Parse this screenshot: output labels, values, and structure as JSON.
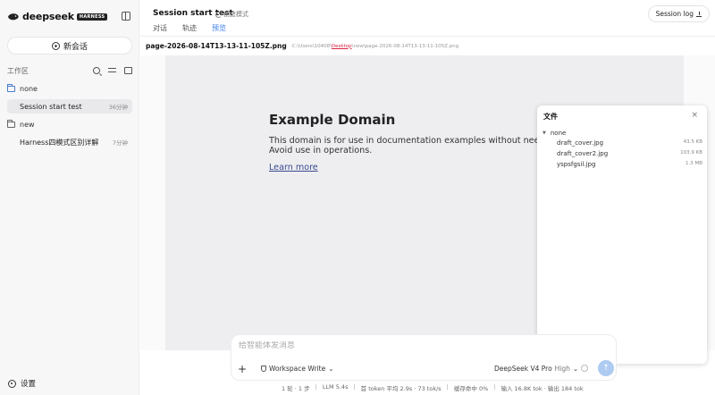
{
  "brand": {
    "name": "deepseek",
    "badge": "HARNESS"
  },
  "sidebar": {
    "new_chat": "新会话",
    "workspace_label": "工作区",
    "groups": [
      {
        "folder": "none",
        "sessions": [
          {
            "name": "Session start test",
            "age": "36分钟",
            "active": true
          }
        ]
      },
      {
        "folder": "new",
        "sessions": [
          {
            "name": "Harness四模式区别详解",
            "age": "7分钟",
            "active": false
          }
        ]
      }
    ],
    "settings": "设置"
  },
  "header": {
    "session_title": "Session start test",
    "mode_tag": "创造模式",
    "tabs": [
      "对话",
      "轨迹",
      "预览"
    ],
    "active_tab": 2,
    "session_log": "Session log"
  },
  "file_bar": {
    "file_name": "page-2026-08-14T13-13-11-105Z.png",
    "path_prefix": "C:\\Users\\10408\\",
    "path_highlight": "Desktop",
    "path_suffix": "\\new\\page-2026-08-14T13-13-11-105Z.png"
  },
  "preview": {
    "title": "Example Domain",
    "para_line1": "This domain is for use in documentation examples without needing pe",
    "para_line2": "Avoid use in operations.",
    "link": "Learn more"
  },
  "files_panel": {
    "title": "文件",
    "close": "×",
    "folder": "none",
    "files": [
      {
        "name": "draft_cover.jpg",
        "size": "43.5 KB"
      },
      {
        "name": "draft_cover2.jpg",
        "size": "103.9 KB"
      },
      {
        "name": "yspsfgsil.jpg",
        "size": "1.3 MB"
      }
    ]
  },
  "composer": {
    "placeholder": "给智能体发消息",
    "add": "+",
    "mode": "Workspace Write",
    "model": "DeepSeek V4 Pro",
    "level": "High",
    "send": "↑"
  },
  "status": {
    "turns": "1 轮 · 1 步",
    "llm": "LLM 5.4s",
    "token": "首 token 平均 2.9s · 73 tok/s",
    "cache": "缓存命中 0%",
    "io": "输入 16.8K tok · 输出 184 tok"
  },
  "colors": {
    "accent": "#3a7ee8",
    "folder": "#4a7bd0",
    "send": "#aecbf2"
  }
}
